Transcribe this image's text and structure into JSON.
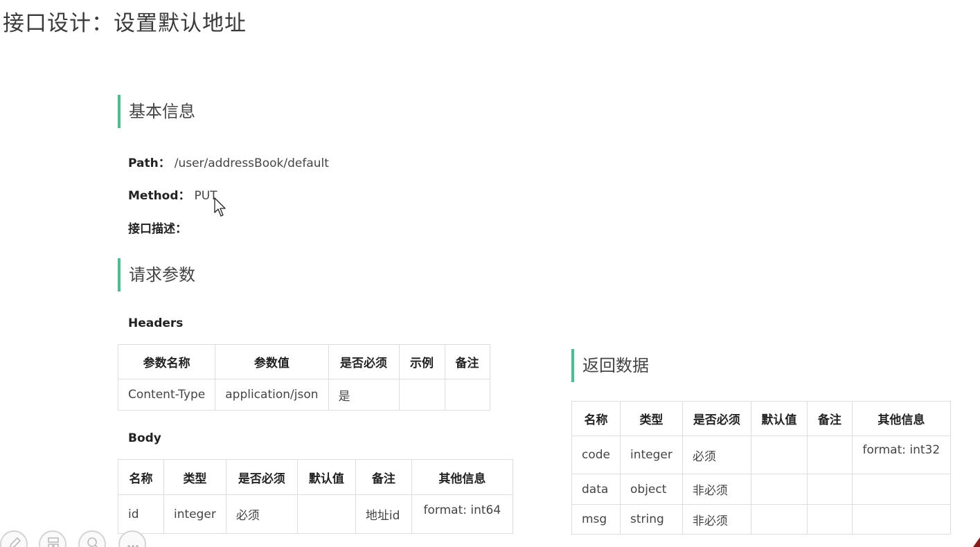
{
  "title": "接口设计：设置默认地址",
  "basic_info": {
    "heading": "基本信息",
    "path_label": "Path：",
    "path_value": "/user/addressBook/default",
    "method_label": "Method：",
    "method_value": "PUT",
    "desc_label": "接口描述："
  },
  "request": {
    "heading": "请求参数",
    "headers_label": "Headers",
    "headers_table": {
      "columns": [
        "参数名称",
        "参数值",
        "是否必须",
        "示例",
        "备注"
      ],
      "rows": [
        [
          "Content-Type",
          "application/json",
          "是",
          "",
          ""
        ]
      ]
    },
    "body_label": "Body",
    "body_table": {
      "columns": [
        "名称",
        "类型",
        "是否必须",
        "默认值",
        "备注",
        "其他信息"
      ],
      "rows": [
        [
          "id",
          "integer",
          "必须",
          "",
          "地址id",
          "format: int64"
        ]
      ]
    }
  },
  "response": {
    "heading": "返回数据",
    "table": {
      "columns": [
        "名称",
        "类型",
        "是否必须",
        "默认值",
        "备注",
        "其他信息"
      ],
      "rows": [
        [
          "code",
          "integer",
          "必须",
          "",
          "",
          "format: int32"
        ],
        [
          "data",
          "object",
          "非必须",
          "",
          "",
          ""
        ],
        [
          "msg",
          "string",
          "非必须",
          "",
          "",
          ""
        ]
      ]
    }
  },
  "toolbar": {
    "icons": [
      "pen-icon",
      "slides-icon",
      "zoom-icon",
      "more-icon"
    ]
  },
  "colors": {
    "accent": "#46c08d",
    "border": "#dddddd",
    "text": "#444444"
  }
}
